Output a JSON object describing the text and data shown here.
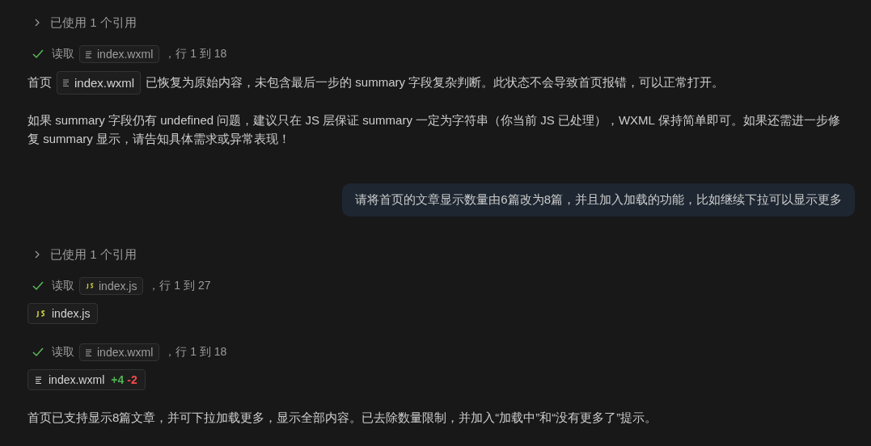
{
  "messages": [
    {
      "kind": "references",
      "label": "已使用 1 个引用",
      "expanded": false
    },
    {
      "kind": "read",
      "verb": "读取",
      "file": {
        "name": "index.wxml",
        "kind": "wxml"
      },
      "range": "，行 1 到 18"
    },
    {
      "kind": "paragraph",
      "parts": [
        {
          "text": "首页"
        },
        {
          "file": {
            "name": "index.wxml",
            "kind": "wxml"
          }
        },
        {
          "text": "已恢复为原始内容，未包含最后一步的 summary 字段复杂判断。此状态不会导致首页报错，可以正常打开。"
        }
      ]
    },
    {
      "kind": "paragraph",
      "parts": [
        {
          "text": "如果 summary 字段仍有 undefined 问题，建议只在 JS 层保证 summary 一定为字符串（你当前 JS 已处理），WXML 保持简单即可。如果还需进一步修复 summary 显示，请告知具体需求或异常表现！"
        }
      ]
    },
    {
      "kind": "user",
      "text": "请将首页的文章显示数量由6篇改为8篇，并且加入加载的功能，比如继续下拉可以显示更多"
    },
    {
      "kind": "references",
      "label": "已使用 1 个引用",
      "expanded": false
    },
    {
      "kind": "read",
      "verb": "读取",
      "file": {
        "name": "index.js",
        "kind": "js"
      },
      "range": "，行 1 到 27"
    },
    {
      "kind": "file",
      "file": {
        "name": "index.js",
        "kind": "js"
      }
    },
    {
      "kind": "read",
      "verb": "读取",
      "file": {
        "name": "index.wxml",
        "kind": "wxml"
      },
      "range": "，行 1 到 18"
    },
    {
      "kind": "file",
      "file": {
        "name": "index.wxml",
        "kind": "wxml"
      },
      "added": "+4",
      "removed": "-2"
    },
    {
      "kind": "paragraph",
      "parts": [
        {
          "text": "首页已支持显示8篇文章，并可下拉加载更多，显示全部内容。已去除数量限制，并加入“加载中”和“没有更多了”提示。"
        }
      ]
    }
  ]
}
